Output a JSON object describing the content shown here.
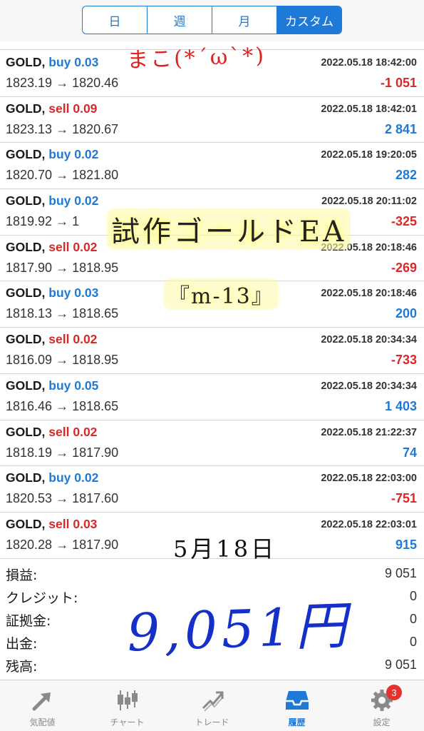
{
  "period_tabs": [
    {
      "label": "日",
      "active": false
    },
    {
      "label": "週",
      "active": false
    },
    {
      "label": "月",
      "active": false
    },
    {
      "label": "カスタム",
      "active": true
    }
  ],
  "trades": [
    {
      "symbol": "GOLD,",
      "side": "buy",
      "side_text": "buy 0.03",
      "time": "2022.05.18 18:42:00",
      "prices": "1823.19 → 1820.46",
      "profit": "-1 051"
    },
    {
      "symbol": "GOLD,",
      "side": "sell",
      "side_text": "sell 0.09",
      "time": "2022.05.18 18:42:01",
      "prices": "1823.13 → 1820.67",
      "profit": "2 841"
    },
    {
      "symbol": "GOLD,",
      "side": "buy",
      "side_text": "buy 0.02",
      "time": "2022.05.18 19:20:05",
      "prices": "1820.70 → 1821.80",
      "profit": "282"
    },
    {
      "symbol": "GOLD,",
      "side": "buy",
      "side_text": "buy 0.02",
      "time": "2022.05.18 20:11:02",
      "prices": "1819.92 → 1",
      "profit": "-325"
    },
    {
      "symbol": "GOLD,",
      "side": "sell",
      "side_text": "sell 0.02",
      "time": "2022.05.18 20:18:46",
      "prices": "1817.90 → 1818.95",
      "profit": "-269"
    },
    {
      "symbol": "GOLD,",
      "side": "buy",
      "side_text": "buy 0.03",
      "time": "2022.05.18 20:18:46",
      "prices": "1818.13 → 1818.65",
      "profit": "200"
    },
    {
      "symbol": "GOLD,",
      "side": "sell",
      "side_text": "sell 0.02",
      "time": "2022.05.18 20:34:34",
      "prices": "1816.09 → 1818.95",
      "profit": "-733"
    },
    {
      "symbol": "GOLD,",
      "side": "buy",
      "side_text": "buy 0.05",
      "time": "2022.05.18 20:34:34",
      "prices": "1816.46 → 1818.65",
      "profit": "1 403"
    },
    {
      "symbol": "GOLD,",
      "side": "sell",
      "side_text": "sell 0.02",
      "time": "2022.05.18 21:22:37",
      "prices": "1818.19 → 1817.90",
      "profit": "74"
    },
    {
      "symbol": "GOLD,",
      "side": "buy",
      "side_text": "buy 0.02",
      "time": "2022.05.18 22:03:00",
      "prices": "1820.53 → 1817.60",
      "profit": "-751"
    },
    {
      "symbol": "GOLD,",
      "side": "sell",
      "side_text": "sell 0.03",
      "time": "2022.05.18 22:03:01",
      "prices": "1820.28 → 1817.90",
      "profit": "915"
    }
  ],
  "summary": [
    {
      "label": "損益:",
      "value": "9 051"
    },
    {
      "label": "クレジット:",
      "value": "0"
    },
    {
      "label": "証拠金:",
      "value": "0"
    },
    {
      "label": "出金:",
      "value": "0"
    },
    {
      "label": "残高:",
      "value": "9 051"
    }
  ],
  "annotations": {
    "red_note": "まこ(*ˊωˋ*)",
    "title": "試作ゴールドEA",
    "code": "『m-13』",
    "date": "5月18日",
    "amount": "9,051円"
  },
  "tabs": [
    {
      "label": "気配値",
      "icon": "quotes-arrow-icon",
      "active": false
    },
    {
      "label": "チャート",
      "icon": "candlestick-chart-icon",
      "active": false
    },
    {
      "label": "トレード",
      "icon": "trade-trend-icon",
      "active": false
    },
    {
      "label": "履歴",
      "icon": "history-tray-icon",
      "active": true
    },
    {
      "label": "設定",
      "icon": "gear-icon",
      "active": false,
      "badge": "3"
    }
  ],
  "colors": {
    "accent": "#1e7ad6",
    "negative": "#d8282a",
    "badge": "#e5322d",
    "handwriting_blue": "#1530c8",
    "handwriting_red": "#e02020",
    "highlighter": "#fffb8c"
  }
}
